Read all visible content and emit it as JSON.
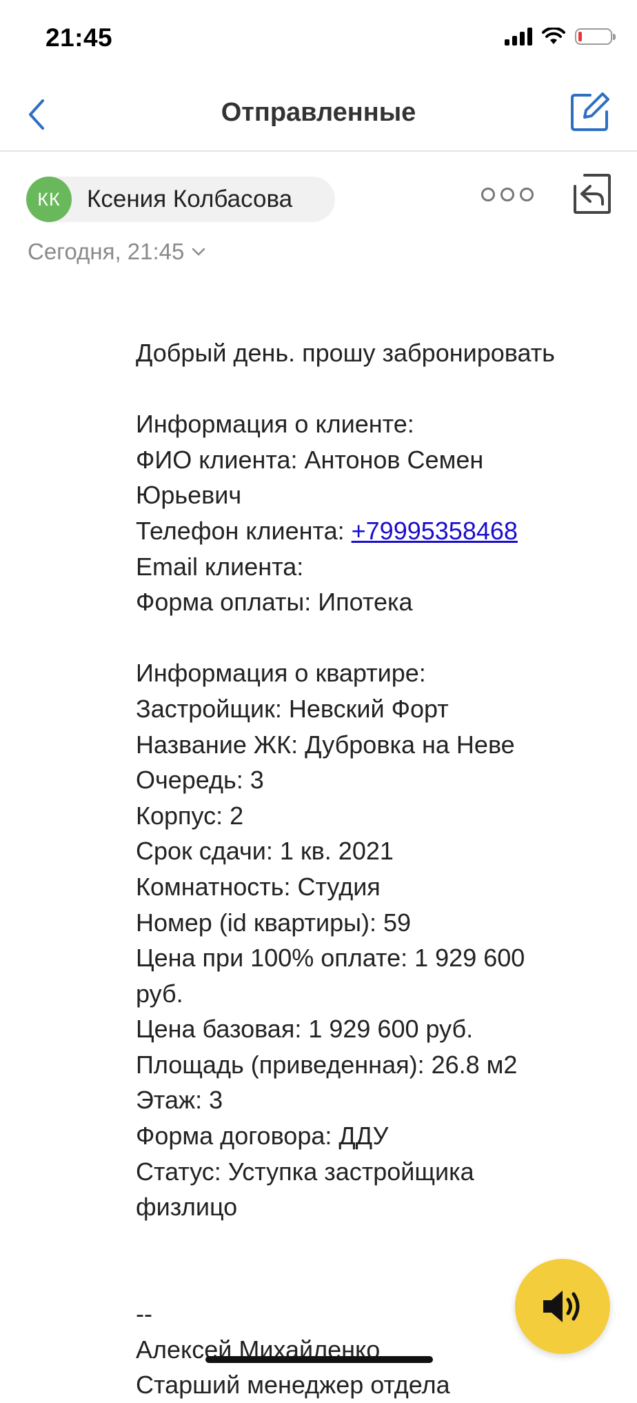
{
  "status_bar": {
    "time": "21:45",
    "battery_level": 0.12
  },
  "nav": {
    "title": "Отправленные"
  },
  "sender": {
    "initials": "КК",
    "name": "Ксения Колбасова",
    "date": "Сегодня, 21:45"
  },
  "message": {
    "greeting": "Добрый день. прошу забронировать",
    "client_header": "Информация о клиенте:",
    "client_name_1": "ФИО клиента: Антонов Семен",
    "client_name_2": "Юрьевич",
    "phone_label": "Телефон клиента: ",
    "phone_value": "+79995358468",
    "email_label": "Email клиента:",
    "payment": "Форма оплаты: Ипотека",
    "flat_header": "Информация о квартире:",
    "developer": "Застройщик: Невский Форт",
    "complex": "Название ЖК: Дубровка на Неве",
    "queue": "Очередь: 3",
    "building": "Корпус: 2",
    "deadline": "Срок сдачи: 1 кв. 2021",
    "rooms": "Комнатность: Студия",
    "flat_id": "Номер (id квартиры): 59",
    "price_full_1": "Цена при 100% оплате: 1 929 600",
    "price_full_2": "руб.",
    "price_base": "Цена базовая: 1 929 600 руб.",
    "area": "Площадь (приведенная): 26.8 м2",
    "floor": "Этаж: 3",
    "contract": "Форма договора: ДДУ",
    "status_1": "Статус: Уступка застройщика",
    "status_2": "физлицо",
    "sig_sep": "--",
    "sig_name": "Алексей Михайленко",
    "sig_title": "Старший менеджер отдела"
  }
}
